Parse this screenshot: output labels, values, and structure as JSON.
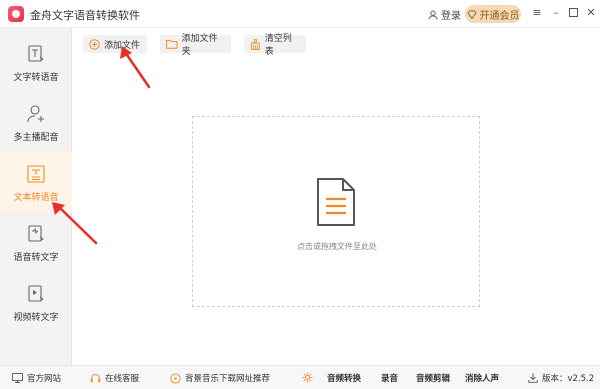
{
  "app": {
    "title": "金舟文字语音转换软件"
  },
  "header": {
    "login_label": "登录",
    "vip_label": "开通会员"
  },
  "sidebar": {
    "items": [
      {
        "label": "文字转语音",
        "icon": "text-doc-icon"
      },
      {
        "label": "多主播配音",
        "icon": "person-add-icon"
      },
      {
        "label": "文本转语音",
        "icon": "text-file-icon",
        "active": true
      },
      {
        "label": "语音转文字",
        "icon": "audio-to-text-icon"
      },
      {
        "label": "视频转文字",
        "icon": "video-to-text-icon"
      }
    ]
  },
  "toolbar": {
    "add_file": "添加文件",
    "add_folder": "添加文件夹",
    "clear_list": "清空列表"
  },
  "dropzone": {
    "hint": "点击或拖拽文件至此处"
  },
  "footer": {
    "website": "官方网站",
    "support": "在线客服",
    "music": "背景音乐下载网址推荐",
    "audio_convert": "音频转换",
    "record": "录音",
    "audio_edit": "音频剪辑",
    "remove_vocals": "消除人声",
    "version": "版本：v2.5.2"
  },
  "colors": {
    "accent": "#f08a24",
    "arrow": "#e8302a",
    "vip_bg": "#f5d9b4"
  }
}
